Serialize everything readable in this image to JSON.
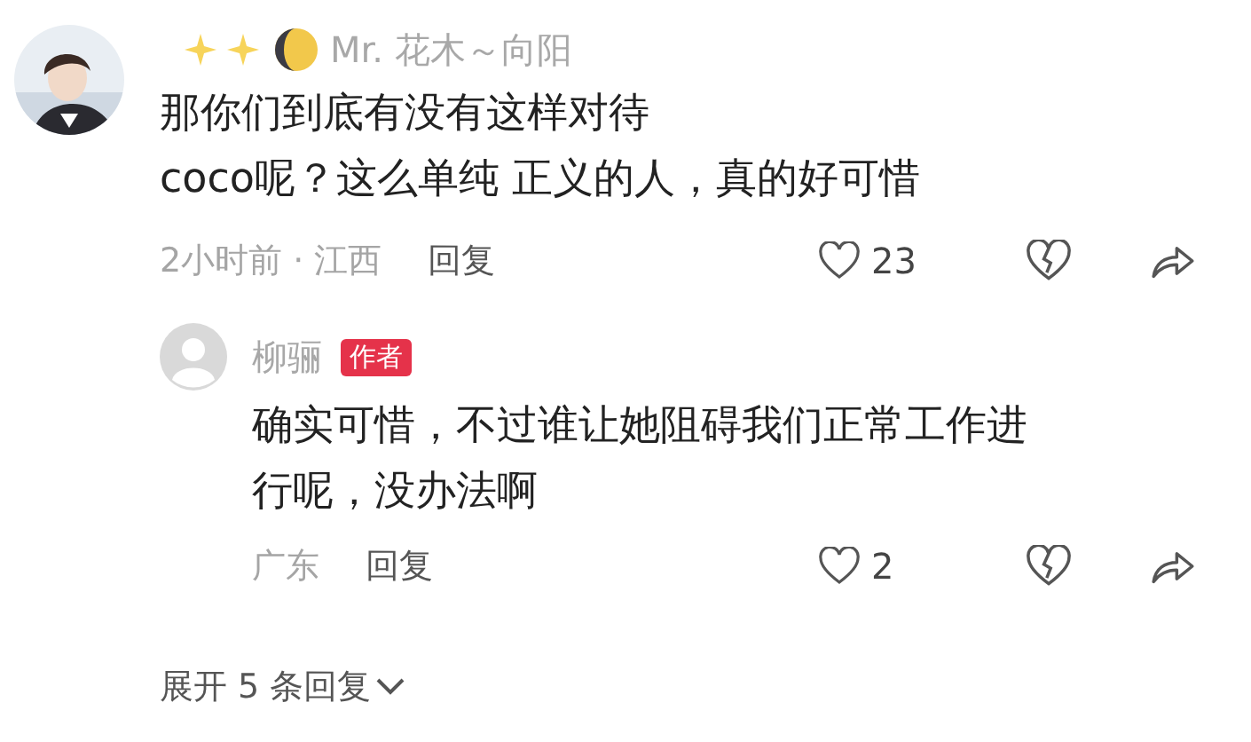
{
  "comment": {
    "author": "Mr. 花木～向阳",
    "lines": [
      "那你们到底有没有这样对待",
      "coco呢？这么单纯 正义的人，真的好可惜"
    ],
    "meta": "2小时前 · 江西",
    "reply_label": "回复",
    "likes": "23",
    "replies": [
      {
        "author": "柳骊",
        "badge": "作者",
        "lines": [
          "确实可惜，不过谁让她阻碍我们正常工作进",
          "行呢，没办法啊"
        ],
        "meta": "广东",
        "reply_label": "回复",
        "likes": "2"
      }
    ],
    "expand": "展开 5 条回复"
  }
}
